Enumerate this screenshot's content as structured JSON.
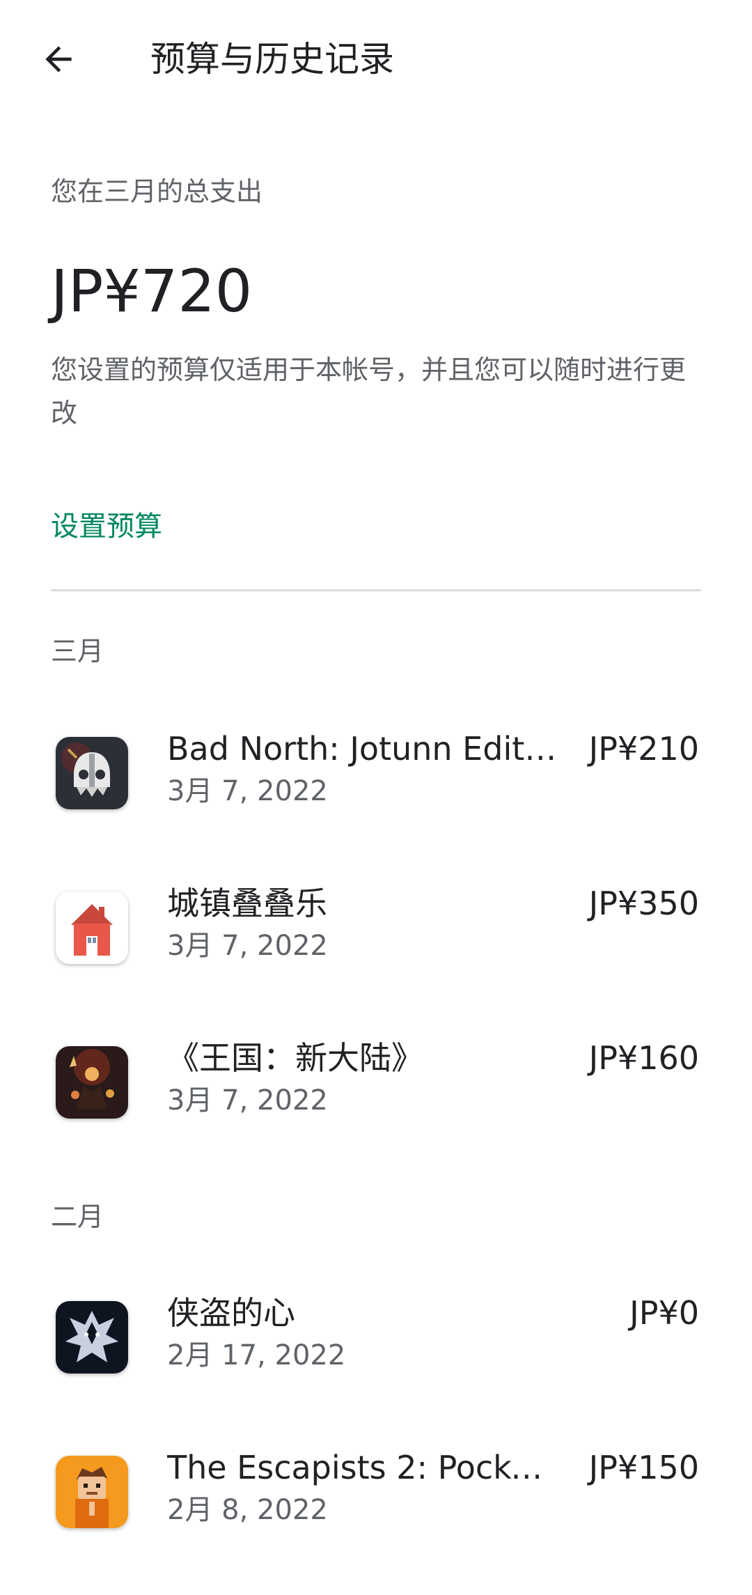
{
  "header": {
    "title": "预算与历史记录",
    "back_icon": "arrow-back-icon"
  },
  "summary": {
    "label": "您在三月的总支出",
    "total": "JP¥720",
    "note": "您设置的预算仅适用于本帐号，并且您可以随时进行更改",
    "set_budget": "设置预算",
    "accent_color": "#01875f"
  },
  "months": [
    {
      "label": "三月",
      "items": [
        {
          "title": "Bad North: Jotunn Editi...",
          "date": "3月 7, 2022",
          "price": "JP¥210",
          "icon": "bad-north-icon"
        },
        {
          "title": "城镇叠叠乐",
          "date": "3月 7, 2022",
          "price": "JP¥350",
          "icon": "townscaper-house-icon"
        },
        {
          "title": "《王国：新大陆》",
          "date": "3月 7, 2022",
          "price": "JP¥160",
          "icon": "kingdom-new-lands-icon"
        }
      ]
    },
    {
      "label": "二月",
      "items": [
        {
          "title": "侠盗的心",
          "date": "2月 17, 2022",
          "price": "JP¥0",
          "icon": "wolf-emblem-icon"
        },
        {
          "title": "The Escapists 2: Pocket...",
          "date": "2月 8, 2022",
          "price": "JP¥150",
          "icon": "escapist-character-icon"
        }
      ]
    }
  ]
}
